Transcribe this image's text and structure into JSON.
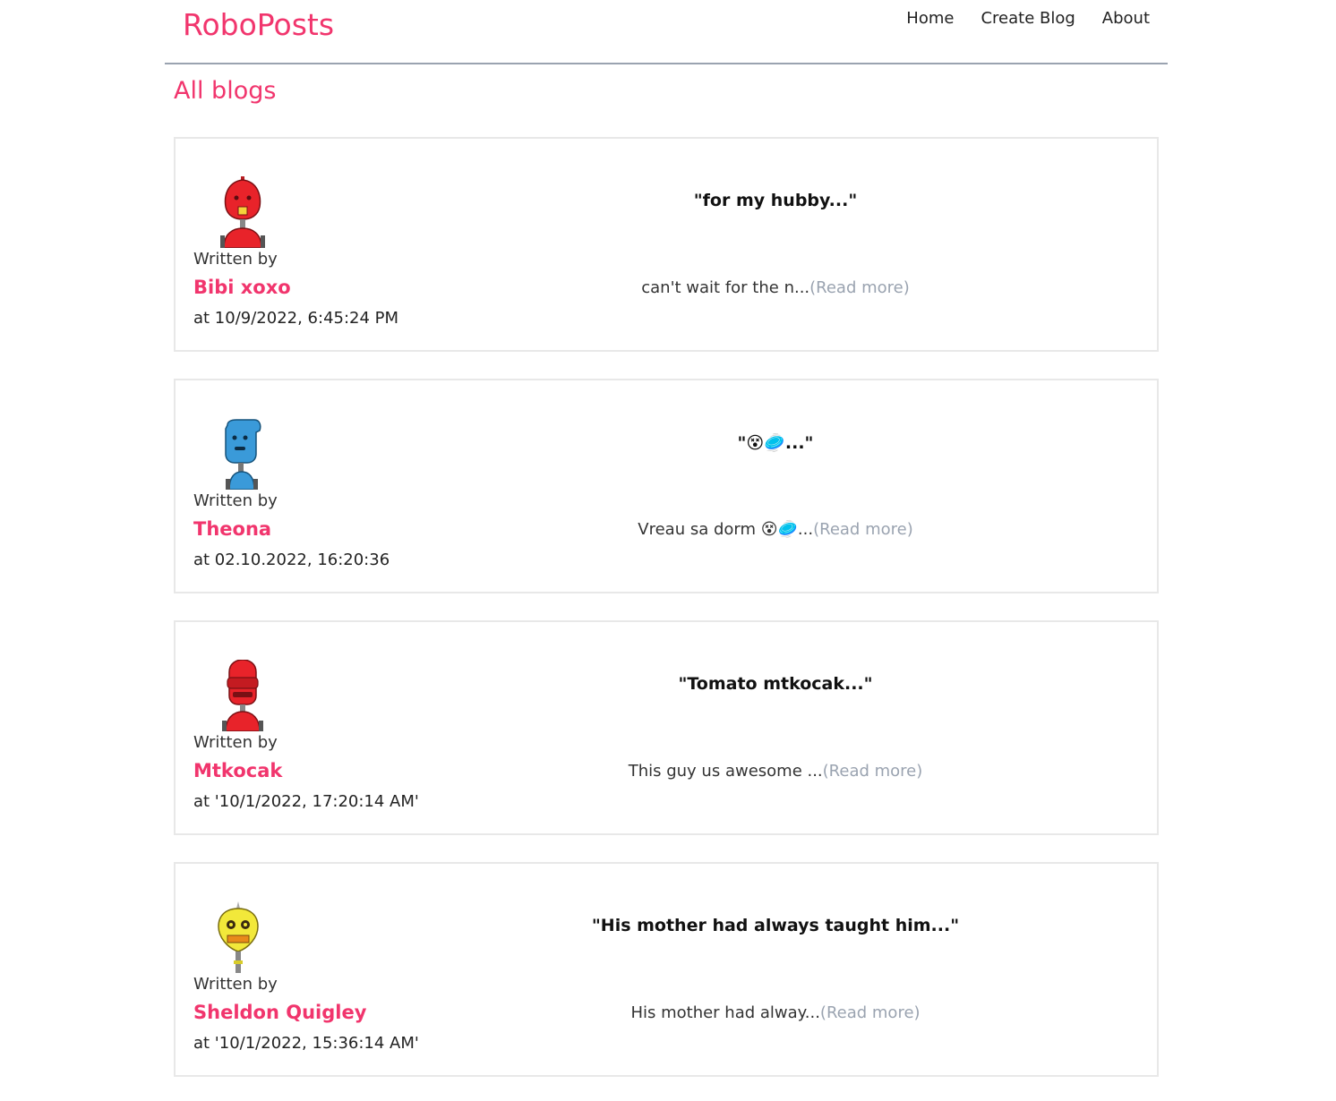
{
  "nav": {
    "brand": "RoboPosts",
    "links": [
      "Home",
      "Create Blog",
      "About"
    ]
  },
  "page_title": "All blogs",
  "written_by_label": "Written by",
  "read_more_label": "(Read more)",
  "blogs": [
    {
      "title": "\"for my hubby...\"",
      "author": "Bibi xoxo",
      "date": "at 10/9/2022, 6:45:24 PM",
      "excerpt": "can't wait for the n...",
      "avatar": "red-robot-icon",
      "avatar_color": "#e8232a"
    },
    {
      "title": "\"😵🥏...\"",
      "author": "Theona",
      "date": "at 02.10.2022, 16:20:36",
      "excerpt": "Vreau sa dorm 😵🥏...",
      "avatar": "blue-robot-icon",
      "avatar_color": "#3a9ad9"
    },
    {
      "title": "\"Tomato mtkocak...\"",
      "author": "Mtkocak",
      "date": "at '10/1/2022, 17:20:14 AM'",
      "excerpt": "This guy us awesome ...",
      "avatar": "red-robot-icon",
      "avatar_color": "#e8232a"
    },
    {
      "title": "\"His mother had always taught him...\"",
      "author": "Sheldon Quigley",
      "date": "at '10/1/2022, 15:36:14 AM'",
      "excerpt": "His mother had alway...",
      "avatar": "yellow-robot-icon",
      "avatar_color": "#f2e83a"
    }
  ],
  "colors": {
    "accent": "#f1356d",
    "muted": "#9aa3b0"
  }
}
